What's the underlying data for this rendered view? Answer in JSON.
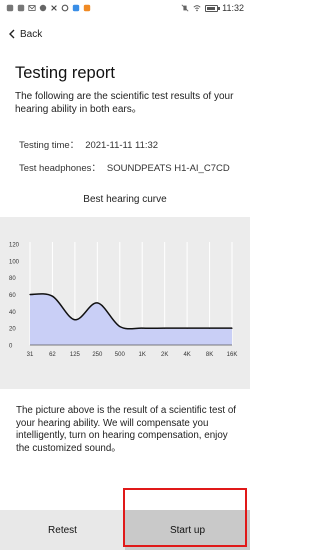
{
  "status_bar": {
    "time": "11:32",
    "left_icons": [
      "notification-icon",
      "notification-icon",
      "mail-icon",
      "notification-icon",
      "close-icon",
      "settings-icon",
      "app-icon",
      "app-icon"
    ],
    "right_icons": [
      "silent-icon",
      "wifi-icon",
      "battery-icon"
    ]
  },
  "header": {
    "back_label": "Back",
    "title": "Testing report",
    "intro": "The following are the scientific test results of your hearing ability in both ears。"
  },
  "meta": {
    "time_label": "Testing time：",
    "time_value": "2021-11-11 11:32",
    "headphones_label": "Test headphones：",
    "headphones_value": "SOUNDPEATS H1-AI_C7CD"
  },
  "chart_data": {
    "type": "area",
    "title": "Best hearing curve",
    "xlabel": "",
    "ylabel": "",
    "categories": [
      "31",
      "62",
      "125",
      "250",
      "500",
      "1K",
      "2K",
      "4K",
      "8K",
      "16K"
    ],
    "yticks": [
      "0",
      "20",
      "40",
      "60",
      "80",
      "100",
      "120"
    ],
    "ylim": [
      0,
      120
    ],
    "series": [
      {
        "values": [
          60,
          58,
          30,
          50,
          22,
          20,
          20,
          20,
          20,
          20
        ]
      }
    ],
    "fill_color": "#c9cff6",
    "line_color": "#111111",
    "grid": "vertical"
  },
  "description": "The picture above is the result of a scientific test of your hearing ability. We will compensate you intelligently, turn on hearing compensation, enjoy the customized sound。",
  "buttons": {
    "retest": "Retest",
    "start_up": "Start up"
  },
  "colors": {
    "highlight": "#e01919",
    "chart_background": "#ececec"
  }
}
